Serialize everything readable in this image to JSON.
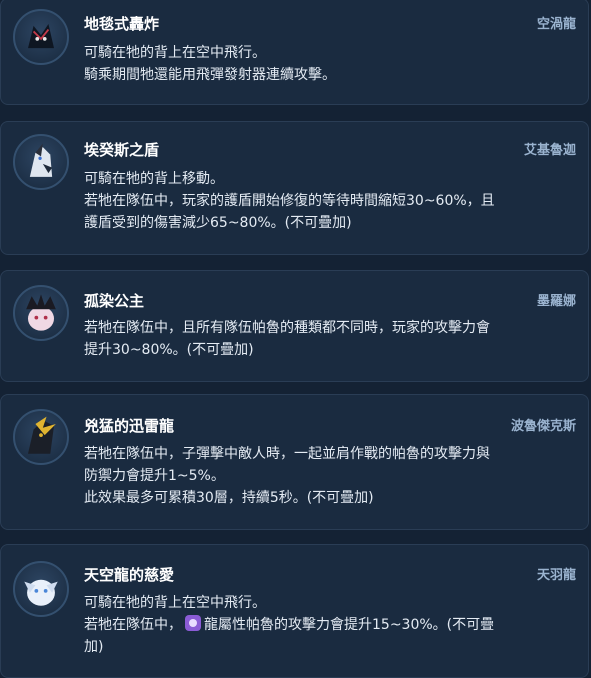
{
  "cards": [
    {
      "name": "地毯式轟炸",
      "pal": "空渦龍",
      "lines": [
        "可騎在牠的背上在空中飛行。",
        "騎乘期間牠還能用飛彈發射器連續攻擊。"
      ]
    },
    {
      "name": "埃癸斯之盾",
      "pal": "艾基魯迦",
      "lines": [
        "可騎在牠的背上移動。",
        "若牠在隊伍中，玩家的護盾開始修復的等待時間縮短30~60%，且",
        "護盾受到的傷害減少65~80%。(不可疊加)"
      ]
    },
    {
      "name": "孤染公主",
      "pal": "墨羅娜",
      "lines": [
        "若牠在隊伍中，且所有隊伍帕魯的種類都不同時，玩家的攻擊力會",
        "提升30~80%。(不可疊加)"
      ]
    },
    {
      "name": "兇猛的迅雷龍",
      "pal": "波魯傑克斯",
      "lines": [
        "若牠在隊伍中，子彈擊中敵人時，一起並肩作戰的帕魯的攻擊力與",
        "防禦力會提升1~5%。",
        "此效果最多可累積30層，持續5秒。(不可疊加)"
      ]
    },
    {
      "name": "天空龍的慈愛",
      "pal": "天羽龍",
      "lines": [
        "可騎在牠的背上在空中飛行。"
      ],
      "line2_prefix": "若牠在隊伍中，",
      "line2_suffix": "龍屬性帕魯的攻擊力會提升15~30%。(不可疊",
      "line3": "加)",
      "dragon_icon": "dragon-element-icon"
    }
  ]
}
